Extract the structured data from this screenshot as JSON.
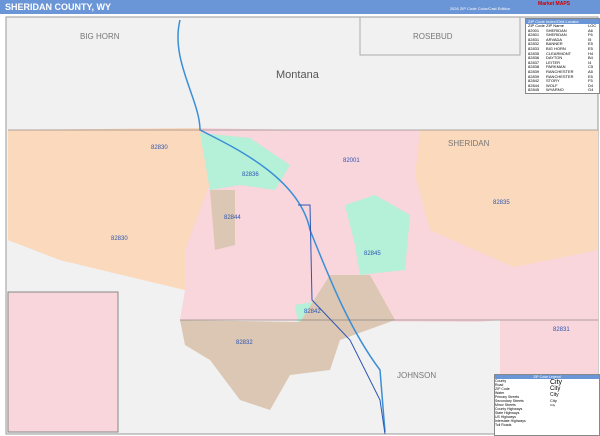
{
  "header": {
    "title": "SHERIDAN COUNTY, WY",
    "edition": "2026 ZIP Code Color/Cast Edition",
    "logo": "Market MAPS"
  },
  "map": {
    "regions": [
      "BIG HORN",
      "ROSEBUD",
      "Montana",
      "SHERIDAN",
      "JOHNSON"
    ],
    "zips": [
      "82830",
      "82001",
      "82836",
      "82844",
      "82835",
      "82845",
      "82842",
      "82832",
      "82831"
    ],
    "colors": {
      "pink": "#f9d5dc",
      "peach": "#fbd9bc",
      "green": "#b5f0d8",
      "tan": "#dcc6b4",
      "gray": "#f1f1f1",
      "water": "#3a8fd6"
    }
  },
  "zip_table": {
    "title": "ZIP Code Index/Grid Locator",
    "headers": [
      "ZIP Code",
      "ZIP Name",
      "LOC"
    ],
    "rows": [
      [
        "82001",
        "SHERIDAN",
        "A6"
      ],
      [
        "82801",
        "SHERIDAN",
        "F6"
      ],
      [
        "82831",
        "ARVADA",
        "I5"
      ],
      [
        "82832",
        "BANNER",
        "E5"
      ],
      [
        "82833",
        "BIG HORN",
        "E5"
      ],
      [
        "82835",
        "CLEARMONT",
        "H4"
      ],
      [
        "82836",
        "DAYTON",
        "B4"
      ],
      [
        "82837",
        "LEITER",
        "I4"
      ],
      [
        "82838",
        "PARKMAN",
        "C5"
      ],
      [
        "82839",
        "RANCHESTER",
        "A5"
      ],
      [
        "82839",
        "RANCHESTER",
        "E5"
      ],
      [
        "82842",
        "STORY",
        "F5"
      ],
      [
        "82844",
        "WOLF",
        "D4"
      ],
      [
        "82845",
        "WYARNO",
        "G4"
      ]
    ]
  },
  "legend": {
    "title": "ZIP Code Legend",
    "items": [
      "County",
      "Road",
      "ZIP Code",
      "Water",
      "Primary Streets",
      "Secondary Streets",
      "Minor Streets",
      "County Highways",
      "State Highways",
      "US Highways",
      "Interstate Highways",
      "Toll Roads"
    ],
    "city_items": [
      "City",
      "City",
      "City",
      "City",
      "City"
    ]
  }
}
